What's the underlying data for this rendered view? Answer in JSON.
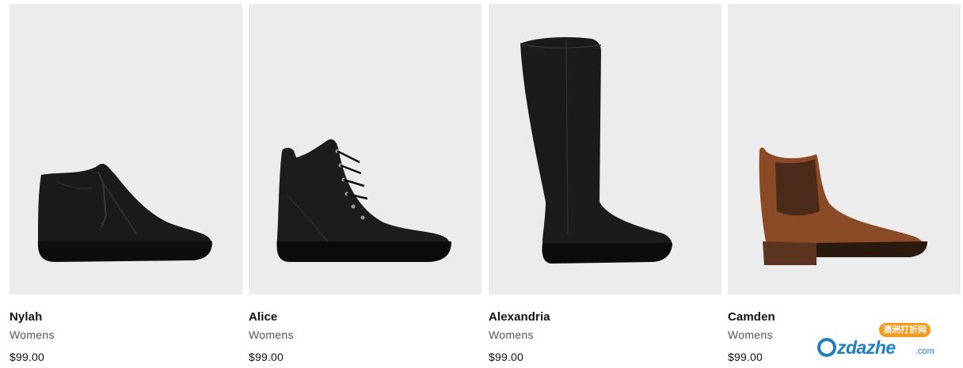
{
  "products": [
    {
      "name": "Nylah",
      "category": "Womens",
      "price": "$99.00",
      "image_icon": "black-zip-ankle-boot"
    },
    {
      "name": "Alice",
      "category": "Womens",
      "price": "$99.00",
      "image_icon": "black-lace-up-boot"
    },
    {
      "name": "Alexandria",
      "category": "Womens",
      "price": "$99.00",
      "image_icon": "black-knee-high-boot"
    },
    {
      "name": "Camden",
      "category": "Womens",
      "price": "$99.00",
      "image_icon": "tan-chelsea-boot"
    }
  ],
  "watermark": {
    "badge": "澳洲打折网",
    "brand_suffix": "zdazhe",
    "domain_suffix": ".com"
  },
  "colors": {
    "tile_background": "#ececec",
    "boot_black": "#1a1a1a",
    "boot_tan": "#8a4a25",
    "watermark_blue": "#1d7ec2",
    "watermark_orange": "#f39a1f"
  }
}
